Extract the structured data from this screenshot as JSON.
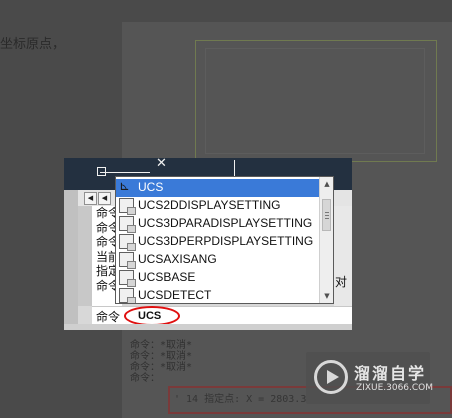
{
  "background": {
    "top_text": "坐标原点，",
    "right_text": "对",
    "command_history": [
      "命令：*取消*",
      "命令：*取消*",
      "命令：*取消*",
      "命令："
    ],
    "highlighted_history": "' 14 指定点:  X = 2803.3"
  },
  "watermark": {
    "title": "溜溜自学",
    "url": "ZIXUE.3066.COM"
  },
  "command_window": {
    "history_lines": [
      "命令",
      "命令",
      "命令",
      "当前",
      "指定",
      "命令"
    ],
    "right_char": "对",
    "prompt_label": "命令",
    "input_value": "UCS",
    "annotation_color": "#e01010"
  },
  "autocomplete": {
    "items": [
      {
        "label": "UCS",
        "icon": "ucs-axis-icon",
        "selected": true
      },
      {
        "label": "UCS2DDISPLAYSETTING",
        "icon": "system-variable-icon",
        "selected": false
      },
      {
        "label": "UCS3DPARADISPLAYSETTING",
        "icon": "system-variable-icon",
        "selected": false
      },
      {
        "label": "UCS3DPERPDISPLAYSETTING",
        "icon": "system-variable-icon",
        "selected": false
      },
      {
        "label": "UCSAXISANG",
        "icon": "system-variable-icon",
        "selected": false
      },
      {
        "label": "UCSBASE",
        "icon": "system-variable-icon",
        "selected": false
      },
      {
        "label": "UCSDETECT",
        "icon": "system-variable-icon",
        "selected": false
      }
    ],
    "selection_color": "#3a7ad8"
  }
}
